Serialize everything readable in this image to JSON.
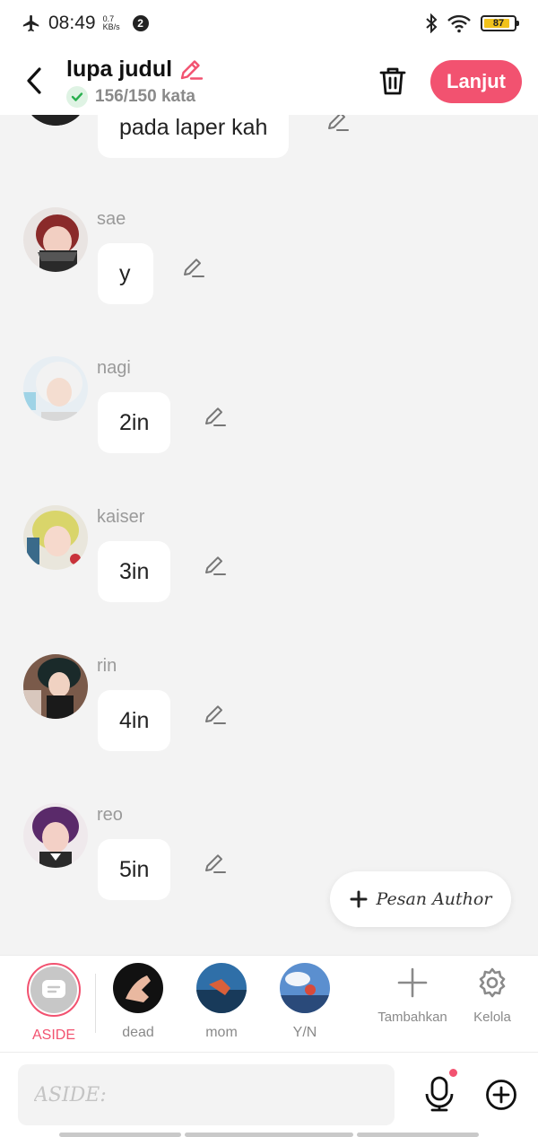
{
  "status": {
    "time": "08:49",
    "speed_value": "0.7",
    "speed_unit": "KB/s",
    "notif_count": "2",
    "battery": "87"
  },
  "header": {
    "title": "lupa judul",
    "word_count": "156/150 kata",
    "next_label": "Lanjut"
  },
  "messages": [
    {
      "sender": "",
      "text": "pada laper kah"
    },
    {
      "sender": "sae",
      "text": "y"
    },
    {
      "sender": "nagi",
      "text": "2in"
    },
    {
      "sender": "kaiser",
      "text": "3in"
    },
    {
      "sender": "rin",
      "text": "4in"
    },
    {
      "sender": "reo",
      "text": "5in"
    }
  ],
  "author_button": "Pesan Author",
  "characters": [
    {
      "label": "ASIDE"
    },
    {
      "label": "dead"
    },
    {
      "label": "mom"
    },
    {
      "label": "Y/N"
    }
  ],
  "tools": {
    "add_label": "Tambahkan",
    "manage_label": "Kelola"
  },
  "input": {
    "placeholder": "ASIDE:"
  },
  "colors": {
    "accent": "#f25270",
    "background": "#f3f3f3",
    "bubble": "#ffffff"
  }
}
